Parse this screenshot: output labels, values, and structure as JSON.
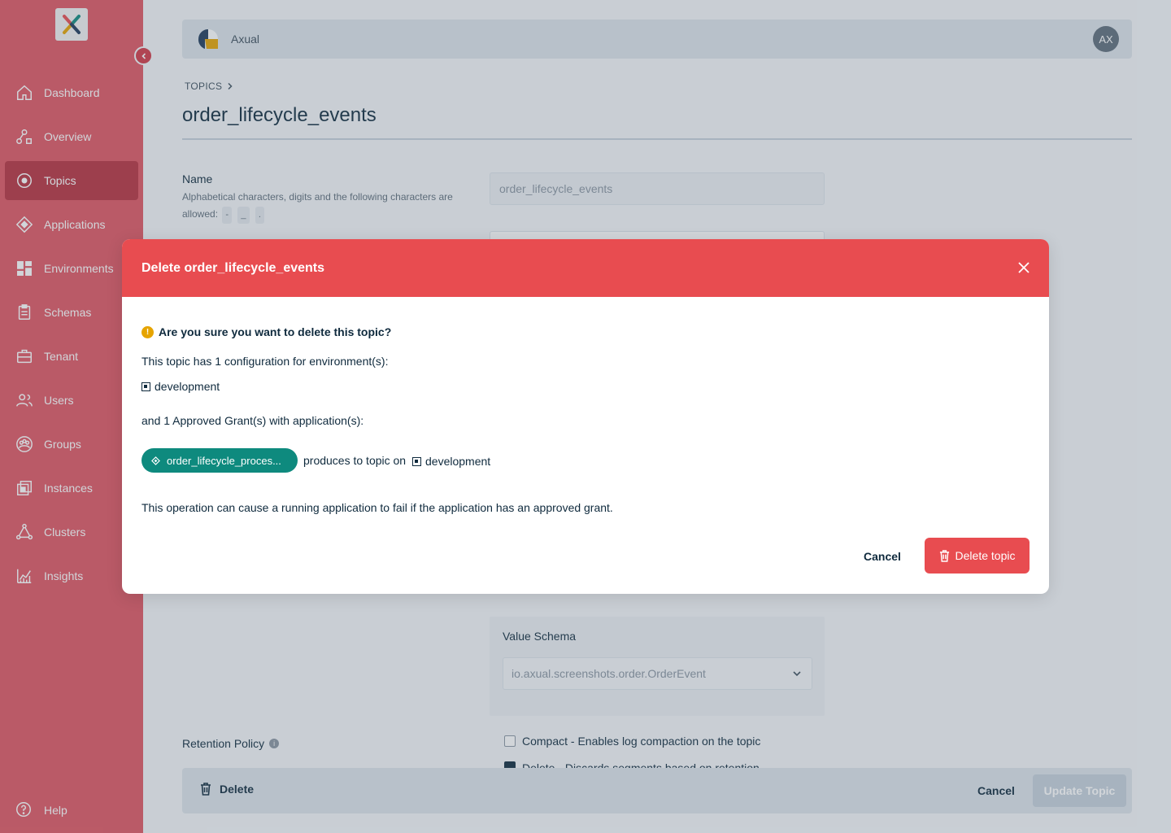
{
  "sidebar": {
    "items": [
      {
        "label": "Dashboard",
        "icon": "home-icon"
      },
      {
        "label": "Overview",
        "icon": "overview-icon"
      },
      {
        "label": "Topics",
        "icon": "topic-icon"
      },
      {
        "label": "Applications",
        "icon": "application-icon"
      },
      {
        "label": "Environments",
        "icon": "grid-icon"
      },
      {
        "label": "Schemas",
        "icon": "clipboard-icon"
      },
      {
        "label": "Tenant",
        "icon": "briefcase-icon"
      },
      {
        "label": "Users",
        "icon": "users-icon"
      },
      {
        "label": "Groups",
        "icon": "group-icon"
      },
      {
        "label": "Instances",
        "icon": "instances-icon"
      },
      {
        "label": "Clusters",
        "icon": "cluster-icon"
      },
      {
        "label": "Insights",
        "icon": "insights-icon"
      }
    ],
    "active": "Topics",
    "help_label": "Help"
  },
  "topbar": {
    "brand": "Axual",
    "avatar_initials": "AX"
  },
  "breadcrumb": {
    "label": "TOPICS"
  },
  "page": {
    "title": "order_lifecycle_events",
    "name_label": "Name",
    "name_help": "Alphabetical characters, digits and the following characters are allowed:",
    "name_chars": [
      "-",
      "_",
      "."
    ],
    "name_value": "order_lifecycle_events",
    "value_schema_label": "Value Schema",
    "value_schema_value": "io.axual.screenshots.order.OrderEvent",
    "retention_label": "Retention Policy",
    "compact_label": "Compact - Enables log compaction on the topic",
    "delete_policy_label": "Delete - Discards segments based on retention"
  },
  "bottombar": {
    "delete_label": "Delete",
    "cancel_label": "Cancel",
    "update_label": "Update Topic"
  },
  "modal": {
    "title": "Delete order_lifecycle_events",
    "question": "Are you sure you want to delete this topic?",
    "config_text": "This topic has 1 configuration for environment(s):",
    "environment": "development",
    "grants_text": "and 1 Approved Grant(s) with application(s):",
    "app_name": "order_lifecycle_proces...",
    "produces_text": "produces to topic on",
    "grant_environment": "development",
    "warning_text": "This operation can cause a running application to fail if the application has an approved grant.",
    "cancel_label": "Cancel",
    "delete_label": "Delete topic"
  },
  "colors": {
    "sidebar": "#e05561",
    "sidebar_active": "#b8303e",
    "modal_header": "#e84c50",
    "app_pill": "#0e8a7e"
  }
}
